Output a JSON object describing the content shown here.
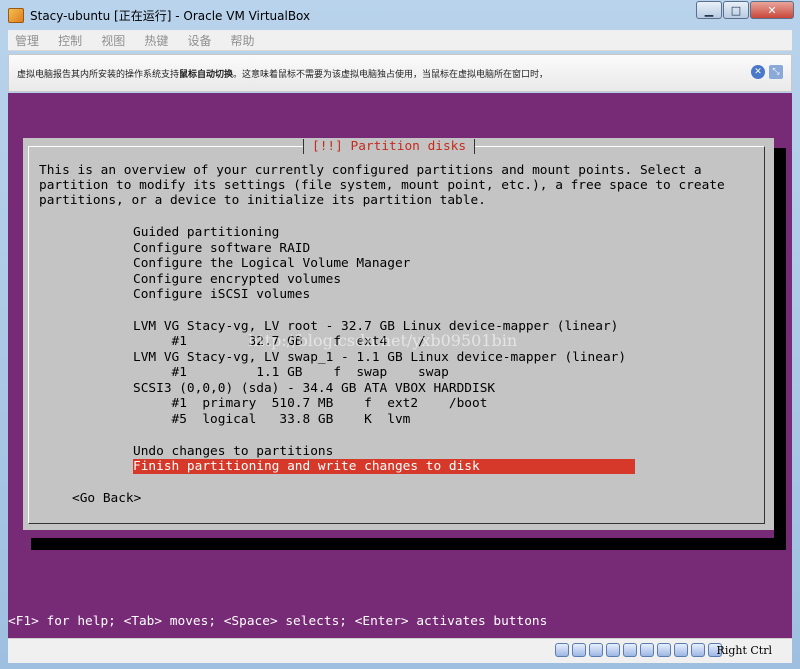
{
  "window": {
    "title": "Stacy-ubuntu [正在运行] - Oracle VM VirtualBox",
    "min_glyph": "▁",
    "max_glyph": "□",
    "close_glyph": "✕"
  },
  "menu": [
    "管理",
    "控制",
    "视图",
    "热键",
    "设备",
    "帮助"
  ],
  "notice": {
    "text_before": "虚拟电脑报告其内所安装的操作系统支持",
    "text_bold": "鼠标自动切换",
    "text_after": "。这意味着鼠标不需要为该虚拟电脑独占使用，当鼠标在虚拟电脑所在窗口时，"
  },
  "installer": {
    "title": "[!!] Partition disks",
    "intro": [
      "This is an overview of your currently configured partitions and mount points. Select a",
      "partition to modify its settings (file system, mount point, etc.), a free space to create",
      "partitions, or a device to initialize its partition table."
    ],
    "actions": [
      "Guided partitioning",
      "Configure software RAID",
      "Configure the Logical Volume Manager",
      "Configure encrypted volumes",
      "Configure iSCSI volumes"
    ],
    "devices": [
      "LVM VG Stacy-vg, LV root - 32.7 GB Linux device-mapper (linear)",
      "     #1        32.7 GB    f  ext4    /",
      "LVM VG Stacy-vg, LV swap_1 - 1.1 GB Linux device-mapper (linear)",
      "     #1         1.1 GB    f  swap    swap",
      "SCSI3 (0,0,0) (sda) - 34.4 GB ATA VBOX HARDDISK",
      "     #1  primary  510.7 MB    f  ext2    /boot",
      "     #5  logical   33.8 GB    K  lvm"
    ],
    "undo": "Undo changes to partitions",
    "finish": "Finish partitioning and write changes to disk",
    "go_back": "<Go Back>",
    "help": "<F1> for help; <Tab> moves; <Space> selects; <Enter> activates buttons",
    "watermark": "http://blog.csdn.net/yxb09501bin"
  },
  "statusbar": {
    "host_key": "Right Ctrl",
    "icons": [
      "hard-disk-icon",
      "optical-drive-icon",
      "usb-icon",
      "shared-folder-icon",
      "display-icon",
      "network-icon",
      "capture-icon",
      "video-capture-icon",
      "mouse-integration-icon",
      "arrow-down-icon"
    ]
  },
  "colors": {
    "console_bg": "#772a76",
    "dialog_bg": "#c4c4c4",
    "selection": "#d6392a",
    "title_red": "#c42b1c"
  }
}
